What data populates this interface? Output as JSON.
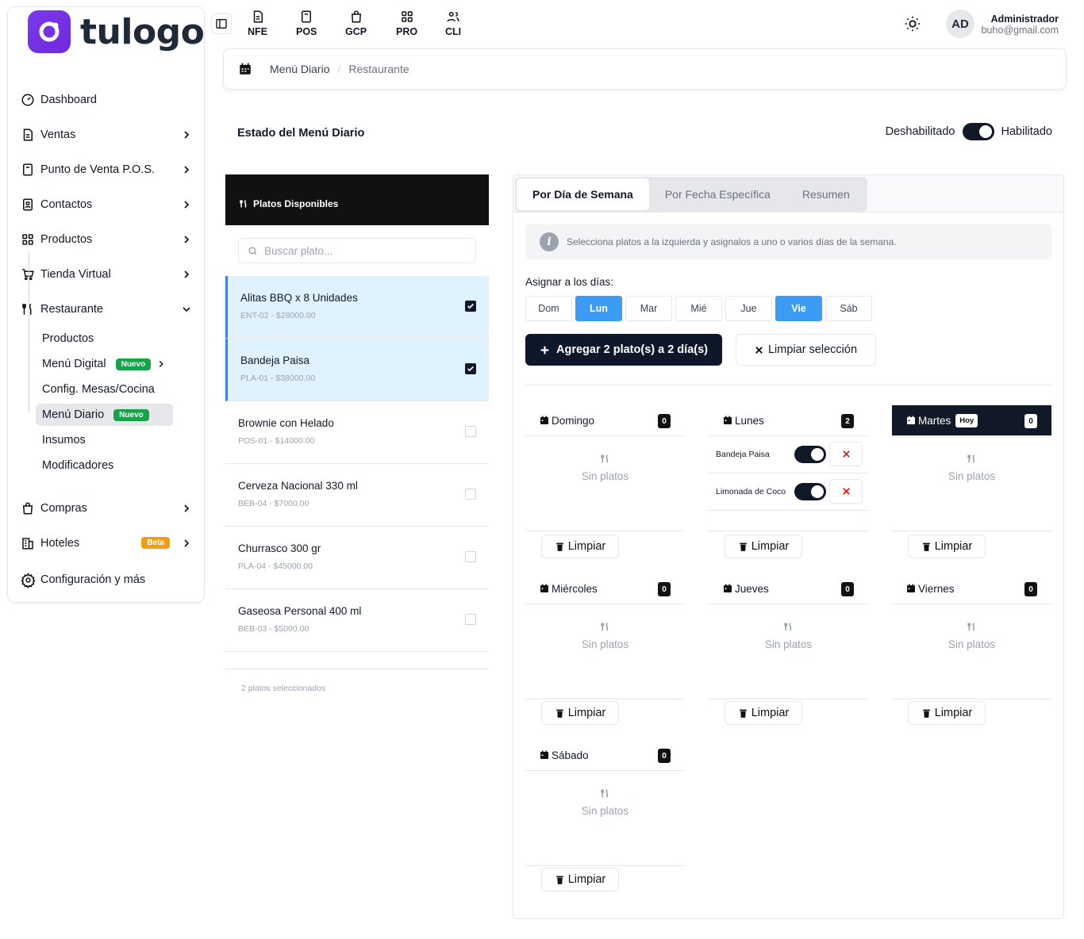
{
  "brand": {
    "name": "tulogo"
  },
  "sidebar": {
    "items": [
      {
        "label": "Dashboard",
        "icon": "gauge-icon"
      },
      {
        "label": "Ventas",
        "icon": "document-icon"
      },
      {
        "label": "Punto de Venta P.O.S.",
        "icon": "pos-icon"
      },
      {
        "label": "Contactos",
        "icon": "contacts-icon"
      },
      {
        "label": "Productos",
        "icon": "grid-icon"
      },
      {
        "label": "Tienda Virtual",
        "icon": "cart-icon"
      },
      {
        "label": "Restaurante",
        "icon": "utensils-icon"
      }
    ],
    "restaurant_sub": [
      {
        "label": "Productos"
      },
      {
        "label": "Menú Digital",
        "badge": "Nuevo"
      },
      {
        "label": "Config. Mesas/Cocina"
      },
      {
        "label": "Menú Diario",
        "badge": "Nuevo"
      },
      {
        "label": "Insumos"
      },
      {
        "label": "Modificadores"
      }
    ],
    "bottom_items": [
      {
        "label": "Compras",
        "icon": "bag-icon"
      },
      {
        "label": "Hoteles",
        "icon": "hotel-icon",
        "badge": "Beta"
      },
      {
        "label": "Configuración y más",
        "icon": "gear-icon"
      }
    ]
  },
  "topbar": {
    "modules": [
      "NFE",
      "POS",
      "GCP",
      "PRO",
      "CLI"
    ],
    "user": {
      "initials": "AD",
      "name": "Administrador",
      "email": "buho@gmail.com"
    }
  },
  "breadcrumb": {
    "parent": "Menú Diario",
    "current": "Restaurante"
  },
  "header": {
    "title": "Estado del Menú Diario",
    "off_label": "Deshabilitado",
    "on_label": "Habilitado",
    "enabled": true
  },
  "dishes": {
    "title": "Platos Disponibles",
    "search_placeholder": "Buscar plato...",
    "items": [
      {
        "name": "Alitas BBQ x 8 Unidades",
        "code": "ENT-02 - $28000.00",
        "selected": true
      },
      {
        "name": "Bandeja Paisa",
        "code": "PLA-01 - $38000.00",
        "selected": true
      },
      {
        "name": "Brownie con Helado",
        "code": "POS-01 - $14000.00",
        "selected": false
      },
      {
        "name": "Cerveza Nacional 330 ml",
        "code": "BEB-04 - $7000.00",
        "selected": false
      },
      {
        "name": "Churrasco 300 gr",
        "code": "PLA-04 - $45000.00",
        "selected": false
      },
      {
        "name": "Gaseosa Personal 400 ml",
        "code": "BEB-03 - $5000.00",
        "selected": false
      }
    ],
    "selected_count": "2 platos seleccionados"
  },
  "tabs": [
    "Por Día de Semana",
    "Por Fecha Específica",
    "Resumen"
  ],
  "info_text": "Selecciona platos a la izquierda y asignalos a uno o varios días de la semana.",
  "assign_label": "Asignar a los días:",
  "day_buttons": [
    {
      "label": "Dom",
      "on": false
    },
    {
      "label": "Lun",
      "on": true
    },
    {
      "label": "Mar",
      "on": false
    },
    {
      "label": "Mié",
      "on": false
    },
    {
      "label": "Jue",
      "on": false
    },
    {
      "label": "Vie",
      "on": true
    },
    {
      "label": "Sáb",
      "on": false
    }
  ],
  "add_button": "Agregar 2 plato(s) a 2 día(s)",
  "clear_button": "Limpiar selección",
  "empty_label": "Sin platos",
  "clear_day_label": "Limpiar",
  "today_badge": "Hoy",
  "days": [
    {
      "name": "Domingo",
      "count": "0"
    },
    {
      "name": "Lunes",
      "count": "2",
      "dishes": [
        "Bandeja Paisa",
        "Limonada de Coco"
      ]
    },
    {
      "name": "Martes",
      "count": "0",
      "today": true
    },
    {
      "name": "Miércoles",
      "count": "0"
    },
    {
      "name": "Jueves",
      "count": "0"
    },
    {
      "name": "Viernes",
      "count": "0"
    },
    {
      "name": "Sábado",
      "count": "0"
    }
  ]
}
